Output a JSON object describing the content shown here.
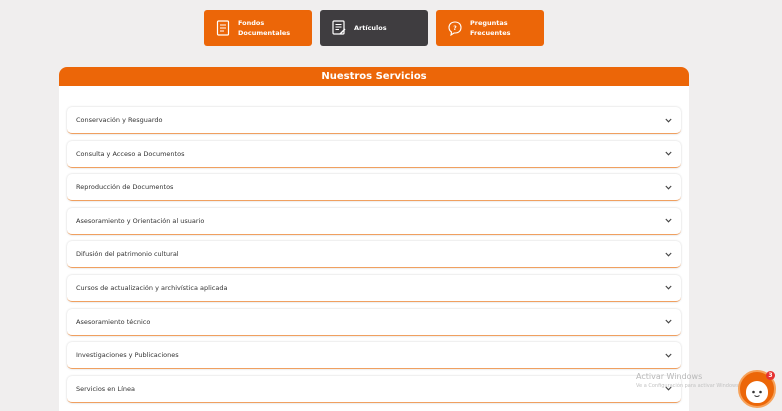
{
  "tiles": [
    {
      "label_line1": "Fondos",
      "label_line2": "Documentales",
      "icon": "document-icon",
      "color": "#ec6608"
    },
    {
      "label": "Artículos",
      "icon": "article-icon",
      "color": "#3f3d40"
    },
    {
      "label_line1": "Preguntas",
      "label_line2": "Frecuentes",
      "icon": "faq-chat-icon",
      "color": "#ec6608"
    }
  ],
  "services": {
    "title": "Nuestros Servicios",
    "items": [
      "Conservación y Resguardo",
      "Consulta y Acceso a Documentos",
      "Reproducción de Documentos",
      "Asesoramiento y Orientación al usuario",
      "Difusión del patrimonio cultural",
      "Cursos de actualización y archivística aplicada",
      "Asesoramiento técnico",
      "Investigaciones y Publicaciones",
      "Servicios en Línea"
    ]
  },
  "watermark": {
    "line1": "Activar Windows",
    "line2": "Ve a Configuración para activar Windows."
  },
  "chatbot": {
    "badge_count": "3",
    "icon": "chatbot-icon"
  },
  "colors": {
    "accent": "#ec6608",
    "dark": "#3f3d40",
    "background": "#f0eeee"
  }
}
